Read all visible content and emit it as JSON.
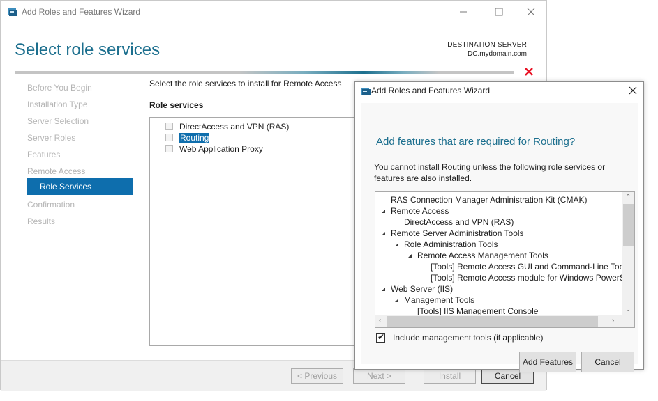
{
  "wizard": {
    "window_title": "Add Roles and Features Wizard",
    "page_title": "Select role services",
    "destination_label": "DESTINATION SERVER",
    "destination_server": "DC.mydomain.com",
    "nav": [
      {
        "label": "Before You Begin"
      },
      {
        "label": "Installation Type"
      },
      {
        "label": "Server Selection"
      },
      {
        "label": "Server Roles"
      },
      {
        "label": "Features"
      },
      {
        "label": "Remote Access"
      },
      {
        "label": "Role Services"
      },
      {
        "label": "Confirmation"
      },
      {
        "label": "Results"
      }
    ],
    "instruction": "Select the role services to install for Remote Access",
    "role_services_heading": "Role services",
    "role_services": [
      {
        "label": "DirectAccess and VPN (RAS)",
        "checked": false
      },
      {
        "label": "Routing",
        "checked": false,
        "selected": true
      },
      {
        "label": "Web Application Proxy",
        "checked": false
      }
    ],
    "buttons": {
      "previous": "< Previous",
      "next": "Next >",
      "install": "Install",
      "cancel": "Cancel"
    }
  },
  "dialog": {
    "title": "Add Roles and Features Wizard",
    "heading": "Add features that are required for Routing?",
    "description": "You cannot install Routing unless the following role services or features are also installed.",
    "features": [
      {
        "label": "RAS Connection Manager Administration Kit (CMAK)",
        "level": 0,
        "expandable": false
      },
      {
        "label": "Remote Access",
        "level": 0,
        "expandable": true
      },
      {
        "label": "DirectAccess and VPN (RAS)",
        "level": 1,
        "expandable": false
      },
      {
        "label": "Remote Server Administration Tools",
        "level": 0,
        "expandable": true
      },
      {
        "label": "Role Administration Tools",
        "level": 1,
        "expandable": true
      },
      {
        "label": "Remote Access Management Tools",
        "level": 2,
        "expandable": true
      },
      {
        "label": "[Tools] Remote Access GUI and Command-Line Tools",
        "level": 3,
        "expandable": false
      },
      {
        "label": "[Tools] Remote Access module for Windows PowerShell",
        "level": 3,
        "expandable": false
      },
      {
        "label": "Web Server (IIS)",
        "level": 0,
        "expandable": true
      },
      {
        "label": "Management Tools",
        "level": 1,
        "expandable": true
      },
      {
        "label": "[Tools] IIS Management Console",
        "level": 2,
        "expandable": false
      }
    ],
    "include_mgmt_label": "Include management tools (if applicable)",
    "include_mgmt_checked": true,
    "check_glyph": "✔",
    "buttons": {
      "add_features": "Add Features",
      "cancel": "Cancel"
    }
  },
  "colors": {
    "accent": "#1c6f8e",
    "selection": "#0e6ead",
    "error": "#e81123"
  }
}
